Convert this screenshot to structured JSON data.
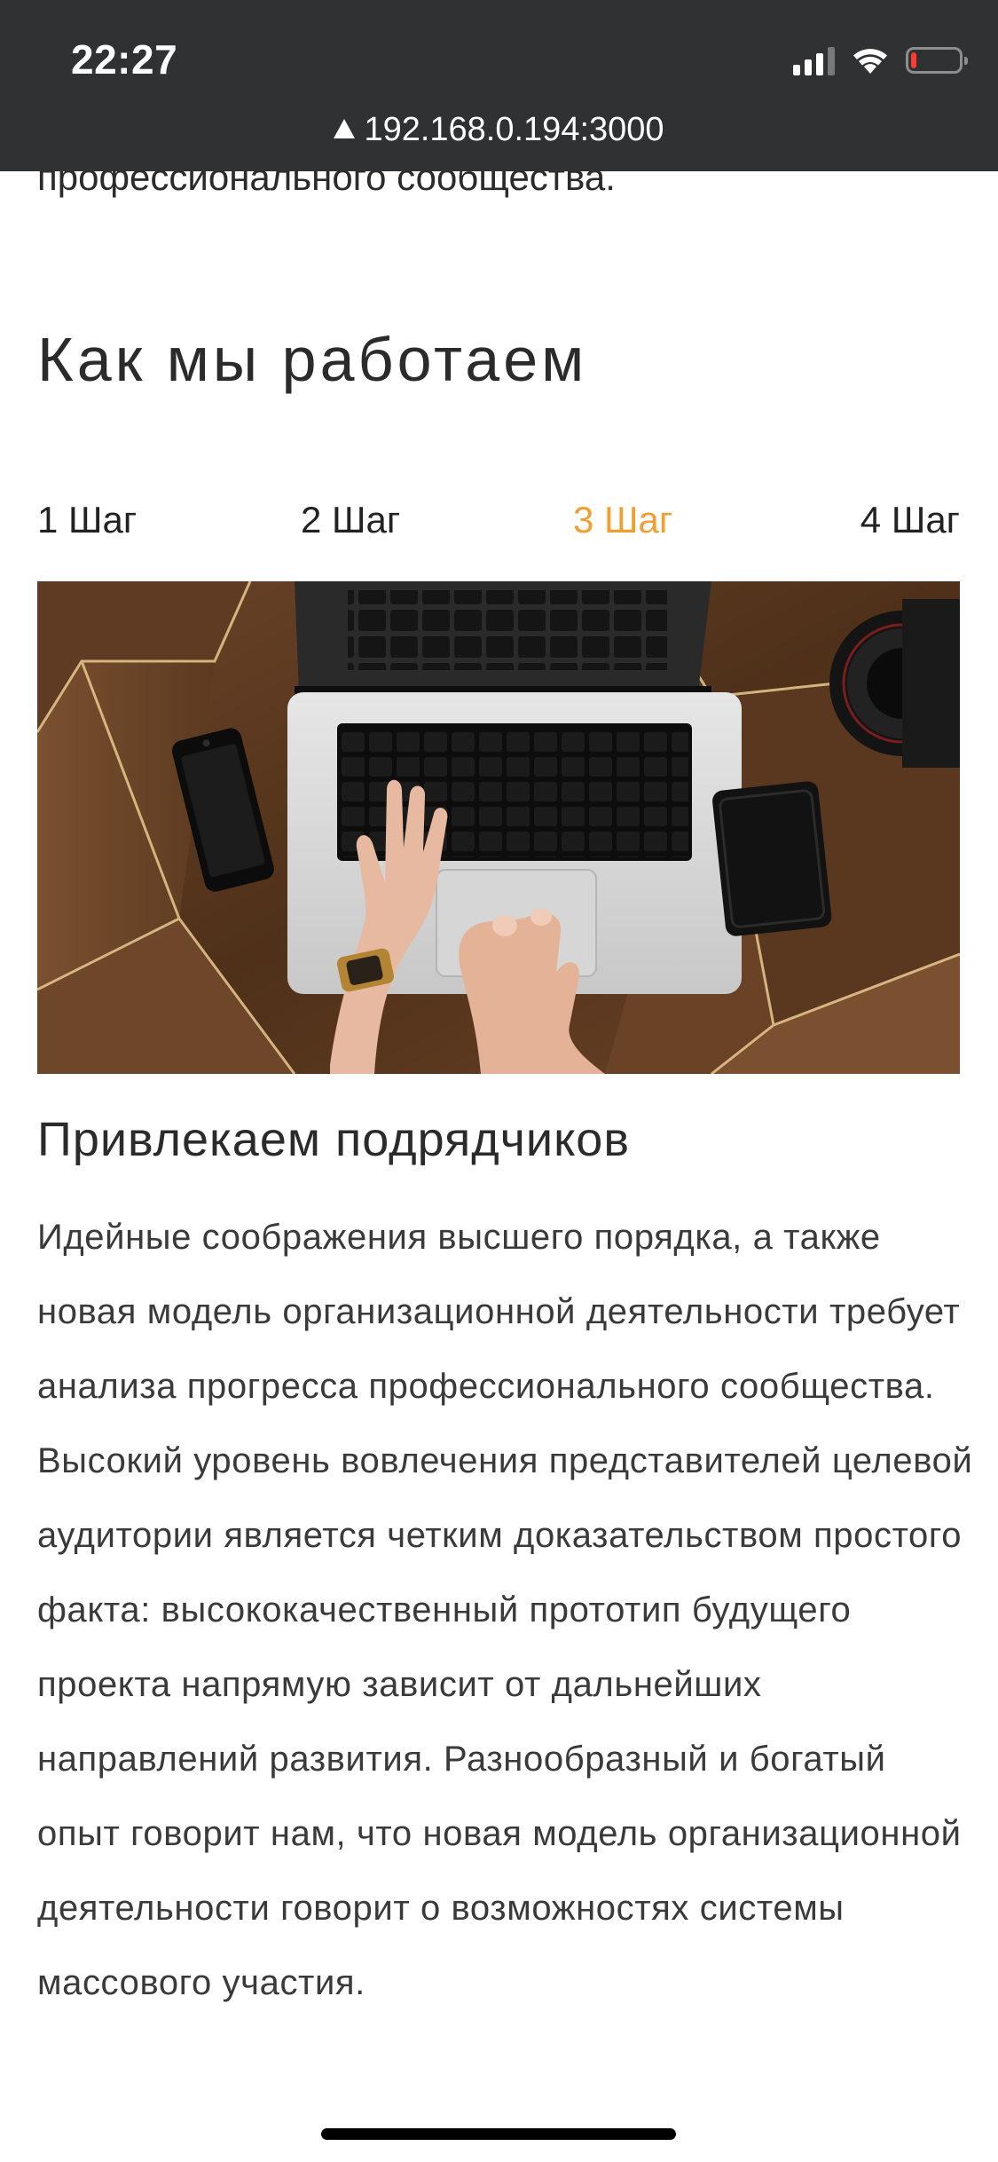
{
  "status_bar": {
    "time": "22:27",
    "icons": [
      "cellular-signal-icon",
      "wifi-icon",
      "battery-icon"
    ]
  },
  "browser": {
    "url": "192.168.0.194:3000",
    "security_icon": "warning-triangle-icon"
  },
  "section": {
    "cutoff_text": "профессионального сообщества.",
    "title": "Как мы работаем",
    "steps": [
      {
        "label": "1 Шаг",
        "active": false
      },
      {
        "label": "2 Шаг",
        "active": false
      },
      {
        "label": "3 Шаг",
        "active": true
      },
      {
        "label": "4 Шаг",
        "active": false
      }
    ],
    "active_color": "#f0a033",
    "image": {
      "description_icon": "laptop-desk-photo",
      "subjects": [
        "laptop",
        "hands",
        "smartphone",
        "wallet",
        "camera-lens",
        "wooden-table"
      ]
    },
    "step_title": "Привлекаем подрядчиков",
    "step_text": "Идейные соображения высшего порядка, а также новая модель организационной деятельности требует анализа прогресса профессионального сообщества. Высокий уровень вовлечения представителей целевой аудитории является четким доказательством простого факта: высококачественный прототип будущего проекта напрямую зависит от дальнейших направлений развития. Разнообразный и богатый опыт говорит нам, что новая модель организационной деятельности говорит о возможностях системы массового участия."
  },
  "colors": {
    "bar_background": "#2f3133",
    "text": "#2b2b2b",
    "accent": "#f0a033"
  }
}
